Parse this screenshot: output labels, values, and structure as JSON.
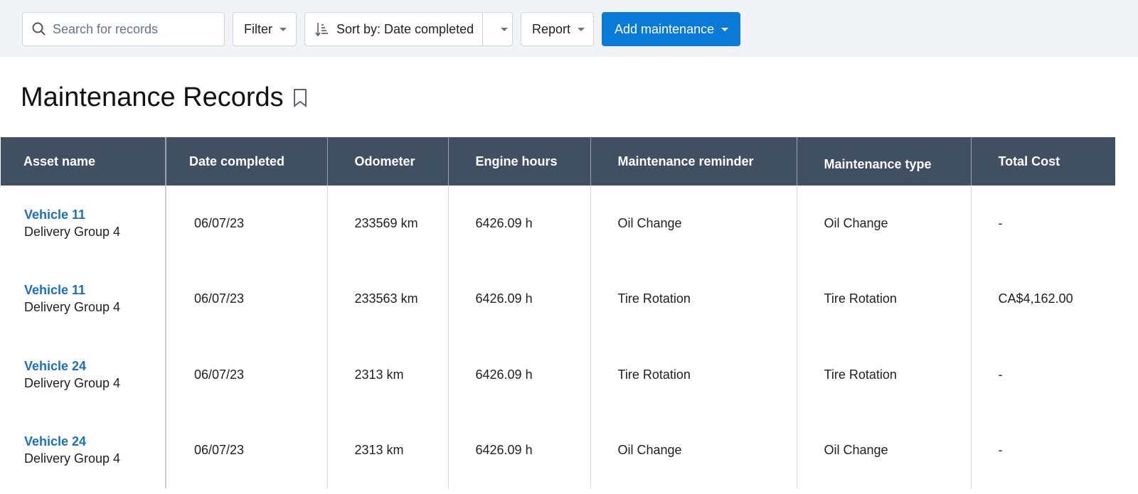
{
  "toolbar": {
    "search_placeholder": "Search for records",
    "filter": "Filter",
    "sort": "Sort by: Date completed",
    "report": "Report",
    "add": "Add maintenance"
  },
  "page_title": "Maintenance Records",
  "table": {
    "headers": [
      "Asset name",
      "Date completed",
      "Odometer",
      "Engine hours",
      "Maintenance reminder",
      "Maintenance type",
      "Total Cost"
    ],
    "rows": [
      {
        "asset": "Vehicle 11",
        "group": "Delivery Group 4",
        "date": "06/07/23",
        "odometer": "233569 km",
        "hours": "6426.09 h",
        "reminder": "Oil Change",
        "type": "Oil Change",
        "cost": "-"
      },
      {
        "asset": "Vehicle 11",
        "group": "Delivery Group 4",
        "date": "06/07/23",
        "odometer": "233563 km",
        "hours": "6426.09 h",
        "reminder": "Tire Rotation",
        "type": "Tire Rotation",
        "cost": "CA$4,162.00"
      },
      {
        "asset": "Vehicle 24",
        "group": "Delivery Group 4",
        "date": "06/07/23",
        "odometer": "2313 km",
        "hours": "6426.09 h",
        "reminder": "Tire Rotation",
        "type": "Tire Rotation",
        "cost": "-"
      },
      {
        "asset": "Vehicle 24",
        "group": "Delivery Group 4",
        "date": "06/07/23",
        "odometer": "2313 km",
        "hours": "6426.09 h",
        "reminder": "Oil Change",
        "type": "Oil Change",
        "cost": "-"
      }
    ]
  }
}
